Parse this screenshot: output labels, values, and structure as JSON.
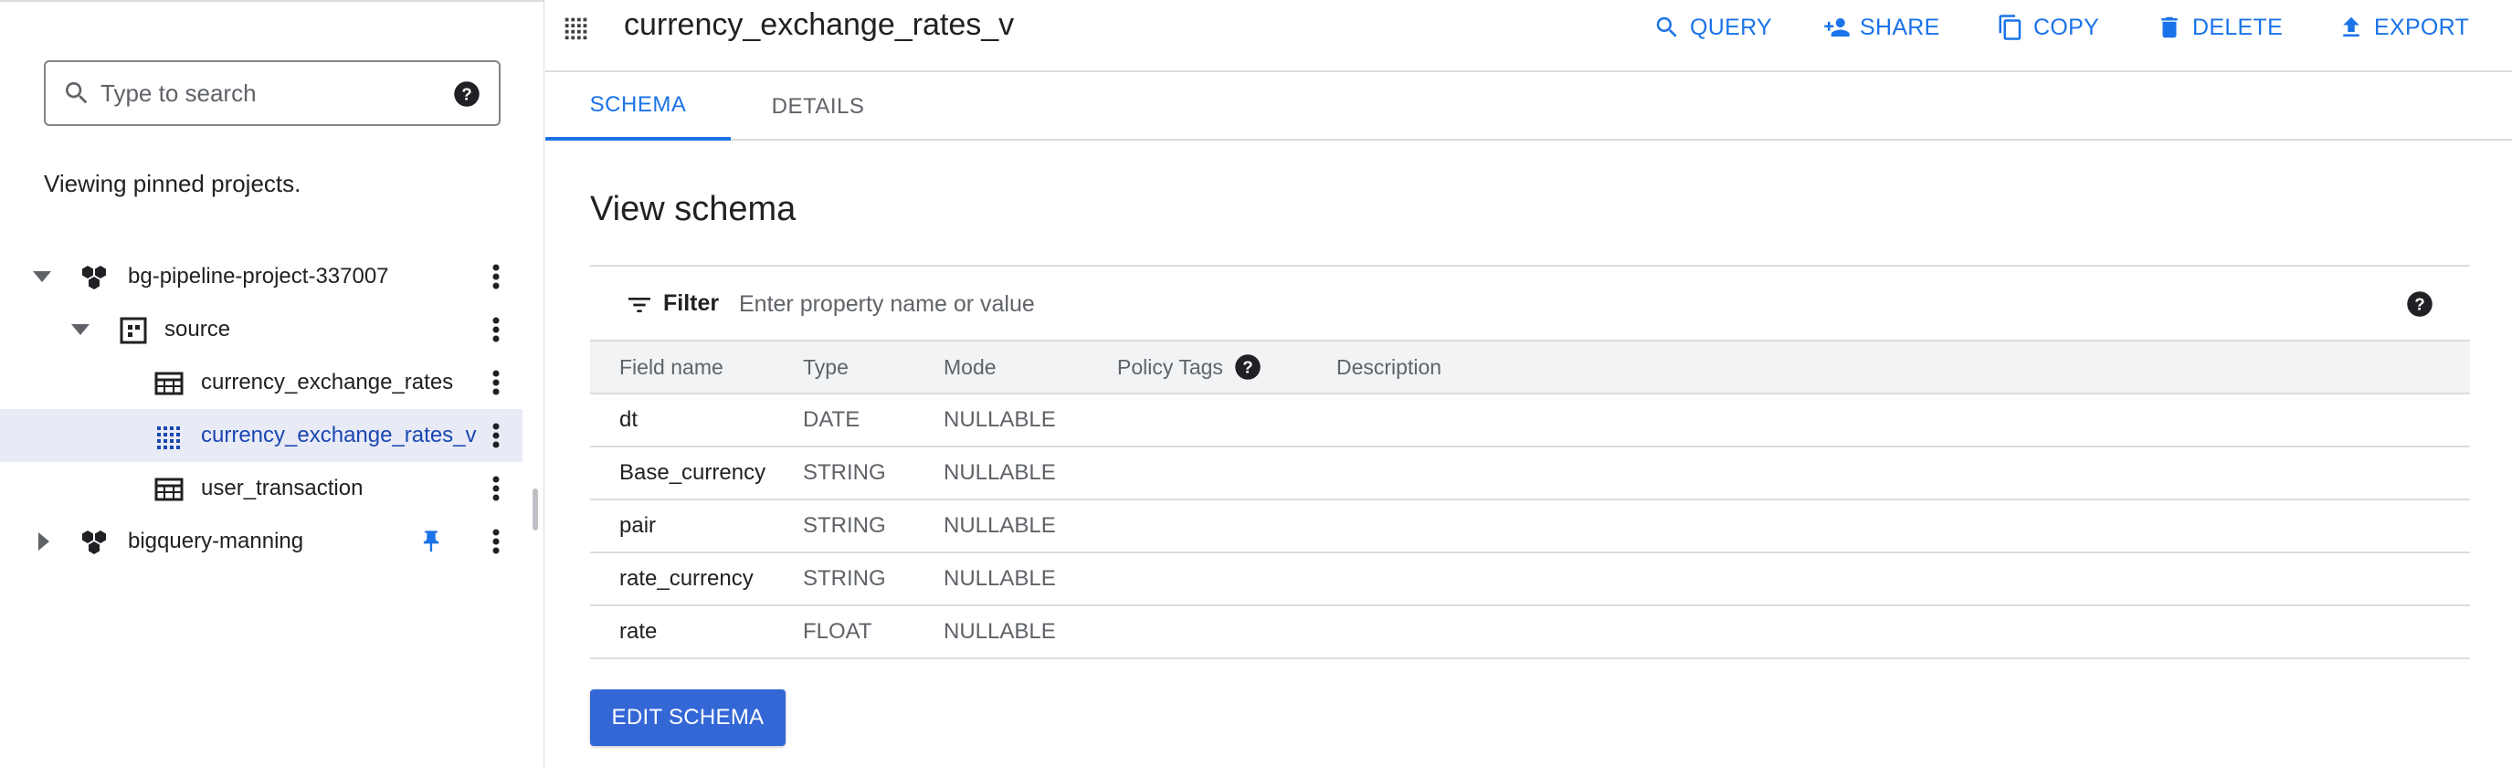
{
  "explorer": {
    "search": {
      "placeholder": "Type to search",
      "value": ""
    },
    "note": "Viewing pinned projects.",
    "tree": [
      {
        "label": "bg-pipeline-project-337007",
        "kind": "project",
        "expanded": true,
        "selected": false
      },
      {
        "label": "source",
        "kind": "dataset",
        "expanded": true,
        "selected": false
      },
      {
        "label": "currency_exchange_rates",
        "kind": "table",
        "selected": false
      },
      {
        "label": "currency_exchange_rates_v",
        "kind": "view",
        "selected": true
      },
      {
        "label": "user_transaction",
        "kind": "table",
        "selected": false
      },
      {
        "label": "bigquery-manning",
        "kind": "project",
        "expanded": false,
        "pinned": true,
        "selected": false
      }
    ]
  },
  "header": {
    "title": "currency_exchange_rates_v",
    "actions": {
      "query": "QUERY",
      "share": "SHARE",
      "copy": "COPY",
      "delete": "DELETE",
      "export": "EXPORT"
    }
  },
  "tabs": {
    "schema": "SCHEMA",
    "details": "DETAILS",
    "active": "schema"
  },
  "schema": {
    "title": "View schema",
    "filter": {
      "label": "Filter",
      "placeholder": "Enter property name or value"
    },
    "columns": [
      "Field name",
      "Type",
      "Mode",
      "Policy Tags",
      "Description"
    ],
    "rows": [
      {
        "name": "dt",
        "type": "DATE",
        "mode": "NULLABLE",
        "policy": "",
        "description": ""
      },
      {
        "name": "Base_currency",
        "type": "STRING",
        "mode": "NULLABLE",
        "policy": "",
        "description": ""
      },
      {
        "name": "pair",
        "type": "STRING",
        "mode": "NULLABLE",
        "policy": "",
        "description": ""
      },
      {
        "name": "rate_currency",
        "type": "STRING",
        "mode": "NULLABLE",
        "policy": "",
        "description": ""
      },
      {
        "name": "rate",
        "type": "FLOAT",
        "mode": "NULLABLE",
        "policy": "",
        "description": ""
      }
    ],
    "edit_button": "EDIT SCHEMA"
  },
  "colors": {
    "accent": "#1a73e8",
    "selected_bg": "#e8eaf6",
    "selected_text": "#1a47b0"
  }
}
